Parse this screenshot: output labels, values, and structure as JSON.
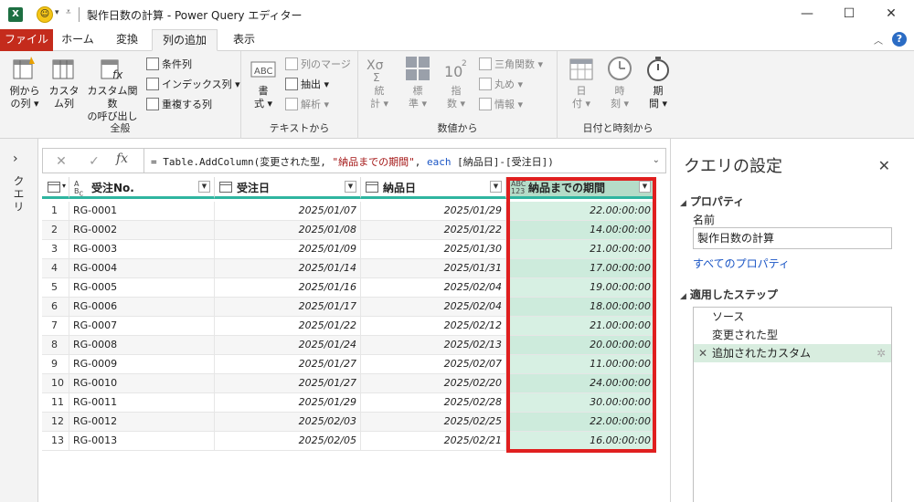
{
  "window": {
    "title": "製作日数の計算 - Power Query エディター",
    "app_icon_letter": "X",
    "minimize": "—",
    "maximize": "☐",
    "close": "✕"
  },
  "tabs": [
    {
      "label": "ファイル"
    },
    {
      "label": "ホーム"
    },
    {
      "label": "変換"
    },
    {
      "label": "列の追加"
    },
    {
      "label": "表示"
    }
  ],
  "ribbon": {
    "general": {
      "label": "全般",
      "example_col": {
        "line1": "例から",
        "line2": "の列 ▾"
      },
      "custom_col": {
        "line1": "カスタ",
        "line2": "ム列"
      },
      "custom_fn": {
        "line1": "カスタム関数",
        "line2": "の呼び出し"
      },
      "conditional": "条件列",
      "index": "インデックス列 ▾",
      "duplicate": "重複する列"
    },
    "text": {
      "label": "テキストから",
      "format": {
        "line1": "書",
        "line2": "式 ▾"
      },
      "merge": "列のマージ",
      "extract": "抽出 ▾",
      "parse": "解析 ▾",
      "abc_icon": "ABC"
    },
    "number": {
      "label": "数値から",
      "stats": {
        "line1": "統",
        "line2": "計 ▾"
      },
      "standard": {
        "line1": "標",
        "line2": "準 ▾"
      },
      "scientific": {
        "line1": "指",
        "line2": "数 ▾"
      },
      "trig": "三角関数 ▾",
      "rounding": "丸め ▾",
      "info": "情報 ▾"
    },
    "datetime": {
      "label": "日付と時刻から",
      "date": {
        "line1": "日",
        "line2": "付 ▾"
      },
      "time": {
        "line1": "時",
        "line2": "刻 ▾"
      },
      "duration": {
        "line1": "期",
        "line2": "間 ▾"
      }
    }
  },
  "querypane": {
    "label": "クエリ"
  },
  "formula": {
    "prefix": "= Table.AddColumn(変更された型, ",
    "str": "\"納品までの期間\"",
    "mid": ", ",
    "kw": "each",
    "suffix": " [納品日]-[受注日])",
    "fx": "fx"
  },
  "grid": {
    "columns": [
      {
        "label": "受注No.",
        "type": "text"
      },
      {
        "label": "受注日",
        "type": "date"
      },
      {
        "label": "納品日",
        "type": "date"
      },
      {
        "label": "納品までの期間",
        "type": "any"
      }
    ],
    "rows": [
      {
        "n": "1",
        "id": "RG-0001",
        "ordered": "2025/01/07",
        "delivered": "2025/01/29",
        "duration": "22.00:00:00"
      },
      {
        "n": "2",
        "id": "RG-0002",
        "ordered": "2025/01/08",
        "delivered": "2025/01/22",
        "duration": "14.00:00:00"
      },
      {
        "n": "3",
        "id": "RG-0003",
        "ordered": "2025/01/09",
        "delivered": "2025/01/30",
        "duration": "21.00:00:00"
      },
      {
        "n": "4",
        "id": "RG-0004",
        "ordered": "2025/01/14",
        "delivered": "2025/01/31",
        "duration": "17.00:00:00"
      },
      {
        "n": "5",
        "id": "RG-0005",
        "ordered": "2025/01/16",
        "delivered": "2025/02/04",
        "duration": "19.00:00:00"
      },
      {
        "n": "6",
        "id": "RG-0006",
        "ordered": "2025/01/17",
        "delivered": "2025/02/04",
        "duration": "18.00:00:00"
      },
      {
        "n": "7",
        "id": "RG-0007",
        "ordered": "2025/01/22",
        "delivered": "2025/02/12",
        "duration": "21.00:00:00"
      },
      {
        "n": "8",
        "id": "RG-0008",
        "ordered": "2025/01/24",
        "delivered": "2025/02/13",
        "duration": "20.00:00:00"
      },
      {
        "n": "9",
        "id": "RG-0009",
        "ordered": "2025/01/27",
        "delivered": "2025/02/07",
        "duration": "11.00:00:00"
      },
      {
        "n": "10",
        "id": "RG-0010",
        "ordered": "2025/01/27",
        "delivered": "2025/02/20",
        "duration": "24.00:00:00"
      },
      {
        "n": "11",
        "id": "RG-0011",
        "ordered": "2025/01/29",
        "delivered": "2025/02/28",
        "duration": "30.00:00:00"
      },
      {
        "n": "12",
        "id": "RG-0012",
        "ordered": "2025/02/03",
        "delivered": "2025/02/25",
        "duration": "22.00:00:00"
      },
      {
        "n": "13",
        "id": "RG-0013",
        "ordered": "2025/02/05",
        "delivered": "2025/02/21",
        "duration": "16.00:00:00"
      }
    ]
  },
  "settings": {
    "title": "クエリの設定",
    "properties": "プロパティ",
    "name_label": "名前",
    "name_value": "製作日数の計算",
    "all_props": "すべてのプロパティ",
    "applied_steps": "適用したステップ",
    "steps": [
      "ソース",
      "変更された型",
      "追加されたカスタム"
    ]
  },
  "colors": {
    "accent_file_tab": "#c42b1c",
    "highlight_border": "#e01f1f",
    "selected_column": "#d7f0e3",
    "header_underline": "#2fb5a0"
  }
}
